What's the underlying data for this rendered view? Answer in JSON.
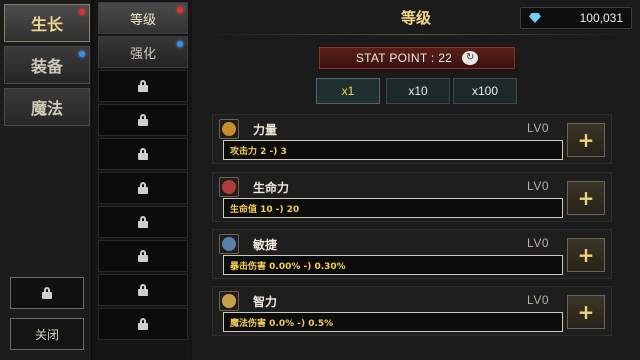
{
  "categories": [
    {
      "label": "生长",
      "dot": "red"
    },
    {
      "label": "装备",
      "dot": "blue"
    },
    {
      "label": "魔法",
      "dot": ""
    }
  ],
  "close_label": "关闭",
  "sub_tabs": [
    {
      "label": "等级",
      "dot": "red"
    },
    {
      "label": "强化",
      "dot": "blue"
    }
  ],
  "locked_tab_count": 8,
  "panel": {
    "title": "等级",
    "currency": {
      "icon": "gem-icon",
      "value": "100,031",
      "color": "#6fd0f5"
    },
    "stat_point_label": "STAT POINT : 22",
    "multipliers": [
      "x1",
      "x10",
      "x100"
    ],
    "active_multiplier": "x1",
    "stats": [
      {
        "name": "力量",
        "level": "LV0",
        "desc": "攻击力 2 -) 3",
        "icon": "fist-icon",
        "icon_color": "#c98a2a"
      },
      {
        "name": "生命力",
        "level": "LV0",
        "desc": "生命值 10 -) 20",
        "icon": "heart-icon",
        "icon_color": "#b43a3a"
      },
      {
        "name": "敏捷",
        "level": "LV0",
        "desc": "暴击伤害 0.00% -) 0.30%",
        "icon": "dagger-icon",
        "icon_color": "#5a7fa8"
      },
      {
        "name": "智力",
        "level": "LV0",
        "desc": "魔法伤害 0.0% -) 0.5%",
        "icon": "brain-icon",
        "icon_color": "#c8a24a"
      }
    ],
    "plus_label": "+"
  },
  "colors": {
    "accent_gold": "#f2d68a",
    "desc_yellow": "#f4cd54",
    "stat_bar_red": "#5a1f18"
  }
}
